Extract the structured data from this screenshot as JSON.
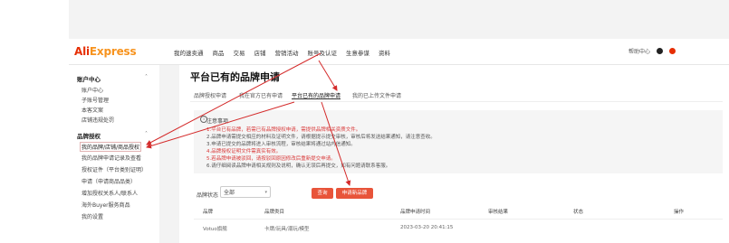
{
  "brand": {
    "ali": "Ali",
    "express": "Express"
  },
  "nav": [
    "我的速卖通",
    "商品",
    "交易",
    "店铺",
    "营销活动",
    "账号及认证",
    "生意参谋",
    "资料"
  ],
  "right_tools": {
    "help": "帮助中心"
  },
  "sidebar": {
    "group1": {
      "label": "账户中心",
      "items": [
        "账户中心",
        "子账号管理",
        "本客文案",
        "店铺违规处罚"
      ]
    },
    "group2": {
      "label": "品牌授权",
      "items": [
        "我的品牌/店铺/商品授权",
        "我的品牌申请记录及查看",
        "授权证件（平台类别证明）",
        "申请（申请商品品类）",
        "增加授权关系人/联系人",
        "海外Buyer服务商品",
        "我的设置"
      ]
    }
  },
  "page": {
    "title": "平台已有的品牌申请",
    "tabs": [
      "品牌授权申请",
      "我在官方已有申请",
      "平台已有的品牌申请",
      "我的已上传文件申请"
    ],
    "notice_title": "注意事项",
    "notice_lines": [
      "1.平台已有品牌，若需已有品牌授权申请，需提供品牌相关资质文件。",
      "2.品牌申请需提交相应的材料及证明文件，请根据提示提交审核，审核后将发送结果通知，请注意查收。",
      "3.申请已提交的品牌将进入审核流程，审核结果将通过站内信通知。",
      "4.品牌授权证明文件需真实有效。",
      "5.若品牌申请被驳回，请按驳回原因修改后重新提交申请。",
      "6.请仔细阅读品牌申请相关规则及说明，确认无误后再提交，如有问题请联系客服。"
    ],
    "notice_red_lines": [
      0,
      3,
      4
    ],
    "filter_label": "品牌状态",
    "filter_value": "全部",
    "query_button": "查询",
    "apply_button": "申请新品牌",
    "table_headers": [
      "品牌",
      "品牌类目",
      "品牌申请时间",
      "审核结果",
      "状态",
      "操作"
    ],
    "table_rows": [
      [
        "Votuo旗舰",
        "卡牌/玩具/潮玩/模型",
        "2023-03-20 20:41:15",
        "",
        "",
        ""
      ]
    ]
  }
}
